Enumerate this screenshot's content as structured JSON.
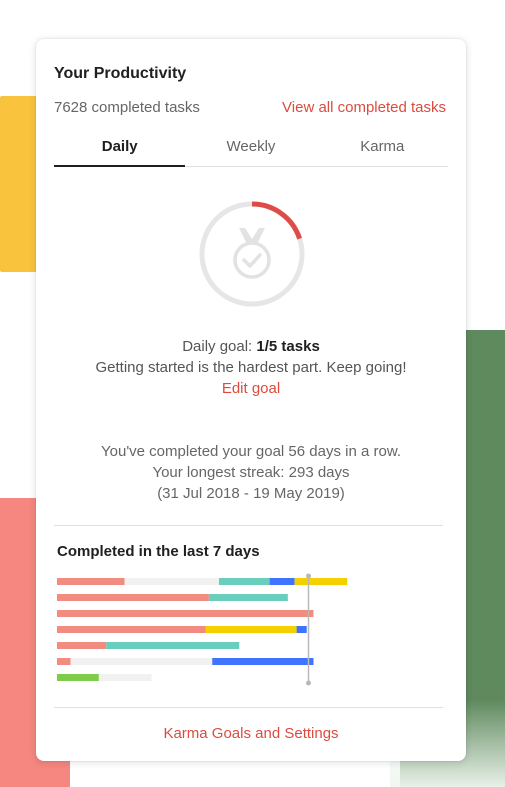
{
  "card": {
    "title": "Your Productivity",
    "completed_count": "7628 completed tasks",
    "view_all_link": "View all completed tasks"
  },
  "tabs": [
    {
      "label": "Daily",
      "active": true
    },
    {
      "label": "Weekly",
      "active": false
    },
    {
      "label": "Karma",
      "active": false
    }
  ],
  "goal": {
    "label": "Daily goal:",
    "value": "1/5 tasks",
    "progress_fraction": 0.2,
    "message": "Getting started is the hardest part. Keep going!",
    "edit_label": "Edit goal",
    "icon": "medal-check-icon"
  },
  "streak": {
    "current": "You've completed your goal 56 days in a row.",
    "longest": "Your longest streak: 293 days",
    "range": "(31 Jul 2018 - 19 May 2019)"
  },
  "chart_title": "Completed in the last 7 days",
  "chart_data": {
    "type": "bar",
    "orientation": "horizontal",
    "stacked": true,
    "goal_marker": 5,
    "rows": [
      {
        "segments": [
          {
            "color": "#f28b80",
            "value": 1
          },
          {
            "color": "#f1f1f1",
            "value": 1.4
          },
          {
            "color": "#6acebd",
            "value": 0.75
          },
          {
            "color": "#4073ff",
            "value": 0.37
          },
          {
            "color": "#f5d000",
            "value": 0.78
          }
        ]
      },
      {
        "segments": [
          {
            "color": "#f28b80",
            "value": 2.25
          },
          {
            "color": "#6acebd",
            "value": 1.17
          }
        ]
      },
      {
        "segments": [
          {
            "color": "#f28b80",
            "value": 3.8
          }
        ]
      },
      {
        "segments": [
          {
            "color": "#f28b80",
            "value": 2.2
          },
          {
            "color": "#f5d000",
            "value": 1.35
          },
          {
            "color": "#4073ff",
            "value": 0.15
          }
        ]
      },
      {
        "segments": [
          {
            "color": "#f28b80",
            "value": 0.73
          },
          {
            "color": "#6acebd",
            "value": 1.97
          }
        ]
      },
      {
        "segments": [
          {
            "color": "#f28b80",
            "value": 0.2
          },
          {
            "color": "#f1f1f1",
            "value": 2.1
          },
          {
            "color": "#4073ff",
            "value": 1.5
          }
        ]
      },
      {
        "segments": [
          {
            "color": "#7ecc49",
            "value": 0.62
          },
          {
            "color": "#f1f1f1",
            "value": 0.78
          }
        ]
      }
    ]
  },
  "footer_link": "Karma Goals and Settings",
  "colors": {
    "accent": "#db4c3f",
    "goal_ring_track": "#e6e6e6",
    "goal_ring_progress": "#de4c4a"
  }
}
